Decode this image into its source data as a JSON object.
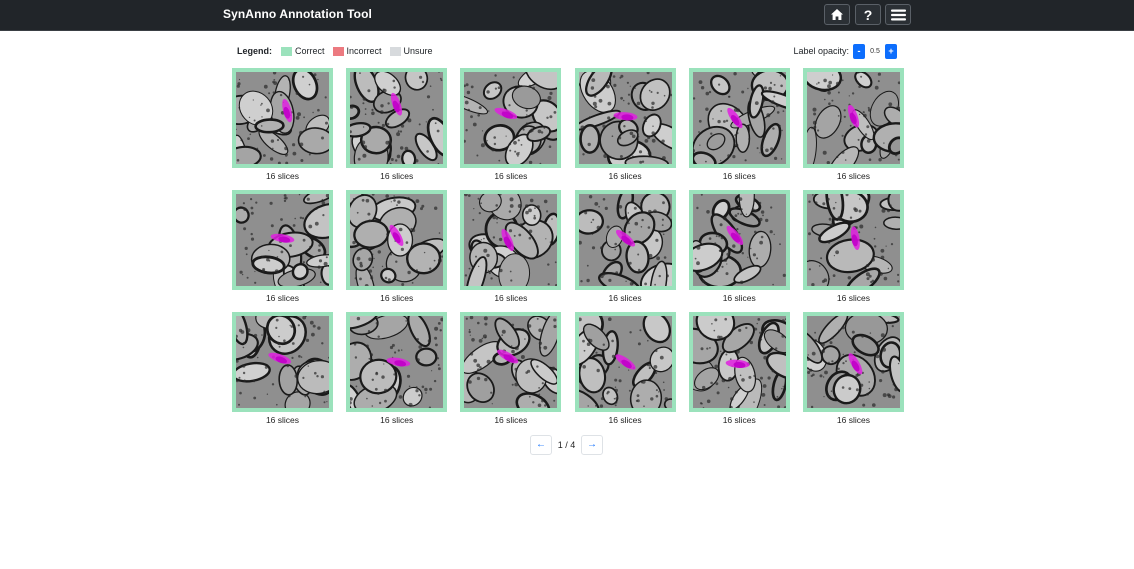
{
  "navbar": {
    "title": "SynAnno Annotation Tool",
    "icons": [
      "home-icon",
      "help-icon",
      "menu-icon"
    ]
  },
  "legend": {
    "title": "Legend:",
    "items": [
      {
        "label": "Correct",
        "color": "#9be2bc"
      },
      {
        "label": "Incorrect",
        "color": "#ec7a80"
      },
      {
        "label": "Unsure",
        "color": "#d7dadd"
      }
    ]
  },
  "opacity": {
    "label": "Label opacity:",
    "decrease": "-",
    "value": "0.5",
    "increase": "+"
  },
  "cards": [
    {
      "caption": "16 slices",
      "status": "Correct"
    },
    {
      "caption": "16 slices",
      "status": "Correct"
    },
    {
      "caption": "16 slices",
      "status": "Correct"
    },
    {
      "caption": "16 slices",
      "status": "Correct"
    },
    {
      "caption": "16 slices",
      "status": "Correct"
    },
    {
      "caption": "16 slices",
      "status": "Correct"
    },
    {
      "caption": "16 slices",
      "status": "Correct"
    },
    {
      "caption": "16 slices",
      "status": "Correct"
    },
    {
      "caption": "16 slices",
      "status": "Correct"
    },
    {
      "caption": "16 slices",
      "status": "Correct"
    },
    {
      "caption": "16 slices",
      "status": "Correct"
    },
    {
      "caption": "16 slices",
      "status": "Correct"
    },
    {
      "caption": "16 slices",
      "status": "Correct"
    },
    {
      "caption": "16 slices",
      "status": "Correct"
    },
    {
      "caption": "16 slices",
      "status": "Correct"
    },
    {
      "caption": "16 slices",
      "status": "Correct"
    },
    {
      "caption": "16 slices",
      "status": "Correct"
    },
    {
      "caption": "16 slices",
      "status": "Correct"
    }
  ],
  "pagination": {
    "prev": "←",
    "indicator": "1 / 4",
    "next": "→"
  }
}
